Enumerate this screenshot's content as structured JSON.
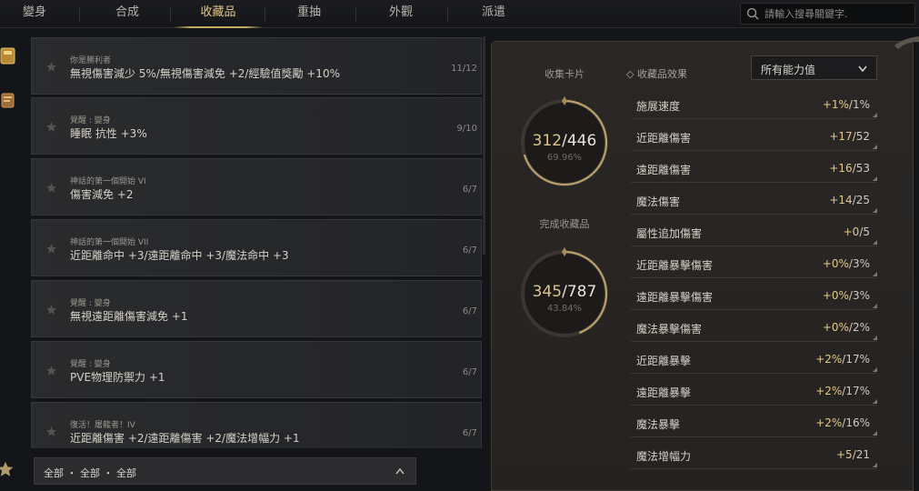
{
  "tabs": [
    {
      "label": "變身"
    },
    {
      "label": "合成"
    },
    {
      "label": "收藏品",
      "active": true
    },
    {
      "label": "重抽"
    },
    {
      "label": "外觀"
    },
    {
      "label": "派遣"
    }
  ],
  "search": {
    "placeholder": "請輸入搜尋關鍵字."
  },
  "items": [
    {
      "category": "你是勝利者",
      "description": "無視傷害減少 5%/無視傷害減免 +2/經驗值獎勵 +10%",
      "progress": "11/12"
    },
    {
      "category": "覺醒 : 變身",
      "description": "睡眠 抗性 +3%",
      "progress": "9/10"
    },
    {
      "category": "神話的第一個開始 VI",
      "description": "傷害減免 +2",
      "progress": "6/7"
    },
    {
      "category": "神話的第一個開始 VII",
      "description": "近距離命中 +3/遠距離命中 +3/魔法命中 +3",
      "progress": "6/7"
    },
    {
      "category": "覺醒 : 變身",
      "description": "無視遠距離傷害減免 +1",
      "progress": "6/7"
    },
    {
      "category": "覺醒 : 變身",
      "description": "PVE物理防禦力 +1",
      "progress": "6/7"
    },
    {
      "category": "復活！屠龍者！IV",
      "description": "近距離傷害 +2/遠距離傷害 +2/魔法增幅力 +1",
      "progress": "6/7"
    }
  ],
  "filter": {
    "label": "全部 ・ 全部 ・ 全部"
  },
  "cards": {
    "label": "收集卡片",
    "current": "312",
    "total": "/446",
    "percent": "69.96%",
    "fraction": 0.6996
  },
  "collections": {
    "label": "完成收藏品",
    "current": "345",
    "total": "/787",
    "percent": "43.84%",
    "fraction": 0.4384
  },
  "effects": {
    "label": "◇ 收藏品效果",
    "dropdown": "所有能力值"
  },
  "stats": [
    {
      "name": "施展速度",
      "current": "+1%",
      "max": "/1%"
    },
    {
      "name": "近距離傷害",
      "current": "+17",
      "max": "/52"
    },
    {
      "name": "遠距離傷害",
      "current": "+16",
      "max": "/53"
    },
    {
      "name": "魔法傷害",
      "current": "+14",
      "max": "/25"
    },
    {
      "name": "屬性追加傷害",
      "current": "+0",
      "max": "/5"
    },
    {
      "name": "近距離暴擊傷害",
      "current": "+0%",
      "max": "/3%"
    },
    {
      "name": "遠距離暴擊傷害",
      "current": "+0%",
      "max": "/3%"
    },
    {
      "name": "魔法暴擊傷害",
      "current": "+0%",
      "max": "/2%"
    },
    {
      "name": "近距離暴擊",
      "current": "+2%",
      "max": "/17%"
    },
    {
      "name": "遠距離暴擊",
      "current": "+2%",
      "max": "/17%"
    },
    {
      "name": "魔法暴擊",
      "current": "+2%",
      "max": "/16%"
    },
    {
      "name": "魔法增幅力",
      "current": "+5",
      "max": "/21"
    }
  ],
  "colors": {
    "accent": "#c8a961",
    "gold_text": "#e4c98a",
    "background": "#141518"
  }
}
